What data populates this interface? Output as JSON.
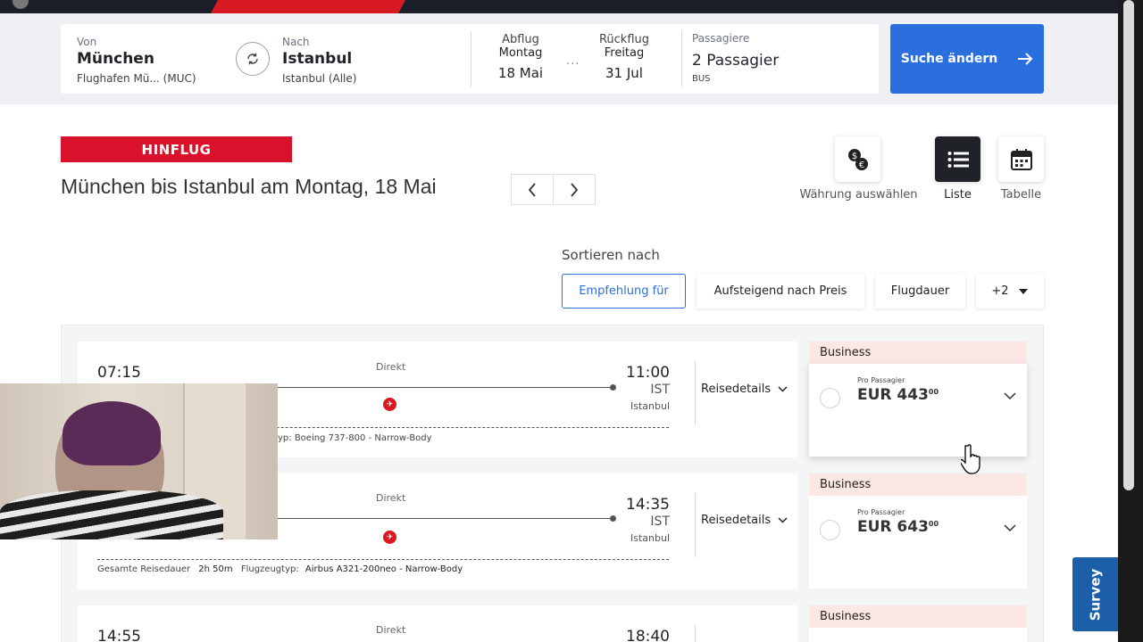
{
  "search": {
    "from_label": "Von",
    "from_city": "München",
    "from_airport": "Flughafen Mü... (MUC)",
    "to_label": "Nach",
    "to_city": "Istanbul",
    "to_airport": "Istanbul (Alle)",
    "outbound_label": "Abflug",
    "outbound_day": "Montag",
    "outbound_date": "18 Mai",
    "dots": "...",
    "return_label": "Rückflug",
    "return_day": "Freitag",
    "return_date": "31 Jul",
    "passengers_label": "Passagiere",
    "passengers_value": "2 Passagier",
    "cabin": "BUS",
    "change_button": "Suche ändern"
  },
  "header": {
    "direction_badge": "HINFLUG",
    "title": "München bis Istanbul am Montag, 18 Mai",
    "currency_label": "Währung auswählen",
    "list_label": "Liste",
    "table_label": "Tabelle"
  },
  "sort": {
    "label": "Sortieren nach",
    "options": [
      "Empfehlung für",
      "Aufsteigend nach Preis",
      "Flugdauer",
      "+2"
    ],
    "selected": "Empfehlung für"
  },
  "flights": [
    {
      "dep_time": "07:15",
      "stops": "Direkt",
      "arr_time": "11:00",
      "arr_code": "IST",
      "arr_city": "Istanbul",
      "meta_visible": "yp: Boeing 737-800 - Narrow-Body",
      "details_label": "Reisedetails",
      "fare_class": "Business",
      "per_passenger": "Pro Passagier",
      "price": "EUR 443",
      "price_cents": "00"
    },
    {
      "dep_time": "",
      "stops": "Direkt",
      "arr_time": "14:35",
      "arr_code": "IST",
      "arr_city": "Istanbul",
      "duration_label": "Gesamte Reisedauer",
      "duration_value": "2h 50m",
      "aircraft_label": "Flugzeugtyp:",
      "aircraft_value": "Airbus A321-200neo - Narrow-Body",
      "details_label": "Reisedetails",
      "fare_class": "Business",
      "per_passenger": "Pro Passagier",
      "price": "EUR 643",
      "price_cents": "00"
    },
    {
      "dep_time": "14:55",
      "stops": "Direkt",
      "arr_time": "18:40",
      "fare_class": "Business"
    }
  ],
  "survey_label": "Survey",
  "colors": {
    "brand_red": "#d9112a",
    "primary_blue": "#2b6fde",
    "survey_blue": "#1c5ea8",
    "fare_header": "#fbe7e4"
  }
}
